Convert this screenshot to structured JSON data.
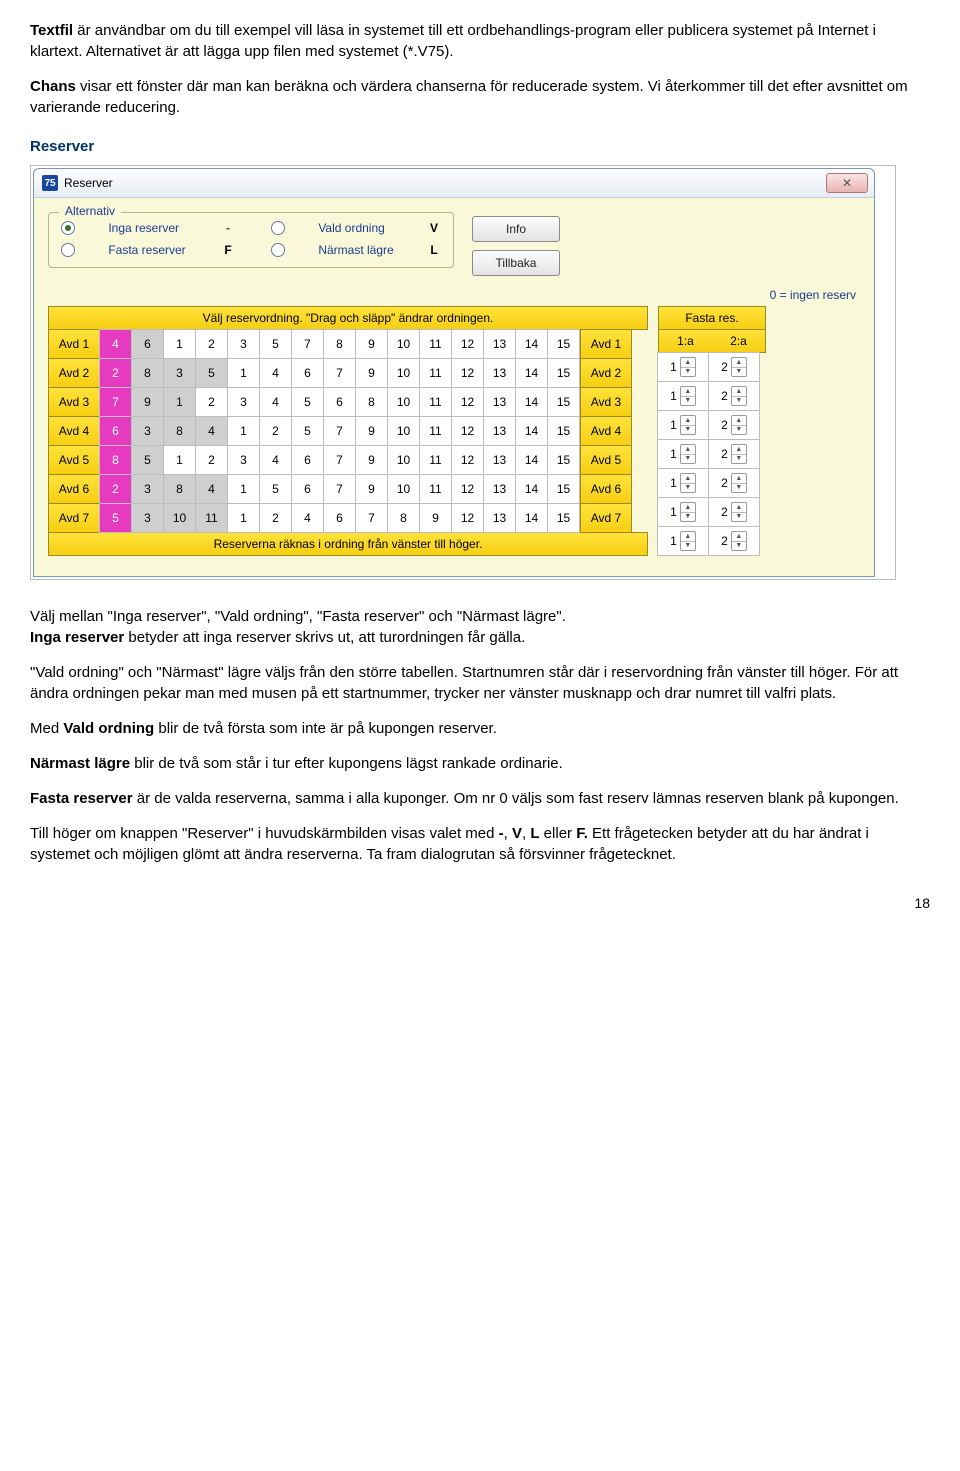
{
  "intro": {
    "textfil_label": "Textfil",
    "p1_rest": " är användbar om du till exempel vill läsa in systemet till ett ordbehandlings-program eller publicera systemet på Internet i klartext. Alternativet är att lägga upp filen med systemet (*.V75).",
    "chans_label": "Chans",
    "p2_rest": " visar ett fönster där man kan beräkna och värdera chanserna för reducerade system. Vi återkommer till det efter avsnittet om varierande reducering."
  },
  "section_heading": "Reserver",
  "dialog": {
    "title": "Reserver",
    "app_icon_text": "75",
    "close_glyph": "✕",
    "group_legend": "Alternativ",
    "radios": {
      "r1": "Inga reserver",
      "k1": "-",
      "r2": "Vald ordning",
      "k2": "V",
      "r3": "Fasta reserver",
      "k3": "F",
      "r4": "Närmast lägre",
      "k4": "L"
    },
    "buttons": {
      "info": "Info",
      "back": "Tillbaka"
    },
    "note_zero": "0 = ingen reserv",
    "main_header": "Välj reservordning. \"Drag och släpp\" ändrar ordningen.",
    "fasta_header": "Fasta res.",
    "fasta_sub1": "1:a",
    "fasta_sub2": "2:a",
    "footer_bar": "Reserverna räknas i ordning från vänster till höger.",
    "avd": [
      "Avd 1",
      "Avd 2",
      "Avd 3",
      "Avd 4",
      "Avd 5",
      "Avd 6",
      "Avd 7"
    ],
    "rows": [
      {
        "cells": [
          {
            "n": "4",
            "c": "mag"
          },
          {
            "n": "6",
            "c": "gray"
          },
          {
            "n": "1"
          },
          {
            "n": "2"
          },
          {
            "n": "3"
          },
          {
            "n": "5"
          },
          {
            "n": "7"
          },
          {
            "n": "8"
          },
          {
            "n": "9"
          },
          {
            "n": "10"
          },
          {
            "n": "11"
          },
          {
            "n": "12"
          },
          {
            "n": "13"
          },
          {
            "n": "14"
          },
          {
            "n": "15"
          }
        ]
      },
      {
        "cells": [
          {
            "n": "2",
            "c": "mag"
          },
          {
            "n": "8",
            "c": "gray"
          },
          {
            "n": "3",
            "c": "gray"
          },
          {
            "n": "5",
            "c": "gray"
          },
          {
            "n": "1"
          },
          {
            "n": "4"
          },
          {
            "n": "6"
          },
          {
            "n": "7"
          },
          {
            "n": "9"
          },
          {
            "n": "10"
          },
          {
            "n": "11"
          },
          {
            "n": "12"
          },
          {
            "n": "13"
          },
          {
            "n": "14"
          },
          {
            "n": "15"
          }
        ]
      },
      {
        "cells": [
          {
            "n": "7",
            "c": "mag"
          },
          {
            "n": "9",
            "c": "gray"
          },
          {
            "n": "1",
            "c": "gray"
          },
          {
            "n": "2"
          },
          {
            "n": "3"
          },
          {
            "n": "4"
          },
          {
            "n": "5"
          },
          {
            "n": "6"
          },
          {
            "n": "8"
          },
          {
            "n": "10"
          },
          {
            "n": "11"
          },
          {
            "n": "12"
          },
          {
            "n": "13"
          },
          {
            "n": "14"
          },
          {
            "n": "15"
          }
        ]
      },
      {
        "cells": [
          {
            "n": "6",
            "c": "mag"
          },
          {
            "n": "3",
            "c": "gray"
          },
          {
            "n": "8",
            "c": "gray"
          },
          {
            "n": "4",
            "c": "gray"
          },
          {
            "n": "1"
          },
          {
            "n": "2"
          },
          {
            "n": "5"
          },
          {
            "n": "7"
          },
          {
            "n": "9"
          },
          {
            "n": "10"
          },
          {
            "n": "11"
          },
          {
            "n": "12"
          },
          {
            "n": "13"
          },
          {
            "n": "14"
          },
          {
            "n": "15"
          }
        ]
      },
      {
        "cells": [
          {
            "n": "8",
            "c": "mag"
          },
          {
            "n": "5",
            "c": "gray"
          },
          {
            "n": "1"
          },
          {
            "n": "2"
          },
          {
            "n": "3"
          },
          {
            "n": "4"
          },
          {
            "n": "6"
          },
          {
            "n": "7"
          },
          {
            "n": "9"
          },
          {
            "n": "10"
          },
          {
            "n": "11"
          },
          {
            "n": "12"
          },
          {
            "n": "13"
          },
          {
            "n": "14"
          },
          {
            "n": "15"
          }
        ]
      },
      {
        "cells": [
          {
            "n": "2",
            "c": "mag"
          },
          {
            "n": "3",
            "c": "gray"
          },
          {
            "n": "8",
            "c": "gray"
          },
          {
            "n": "4",
            "c": "gray"
          },
          {
            "n": "1"
          },
          {
            "n": "5"
          },
          {
            "n": "6"
          },
          {
            "n": "7"
          },
          {
            "n": "9"
          },
          {
            "n": "10"
          },
          {
            "n": "11"
          },
          {
            "n": "12"
          },
          {
            "n": "13"
          },
          {
            "n": "14"
          },
          {
            "n": "15"
          }
        ]
      },
      {
        "cells": [
          {
            "n": "5",
            "c": "mag"
          },
          {
            "n": "3",
            "c": "gray"
          },
          {
            "n": "10",
            "c": "gray"
          },
          {
            "n": "11",
            "c": "gray"
          },
          {
            "n": "1"
          },
          {
            "n": "2"
          },
          {
            "n": "4"
          },
          {
            "n": "6"
          },
          {
            "n": "7"
          },
          {
            "n": "8"
          },
          {
            "n": "9"
          },
          {
            "n": "12"
          },
          {
            "n": "13"
          },
          {
            "n": "14"
          },
          {
            "n": "15"
          }
        ]
      }
    ],
    "fasta_rows": [
      {
        "a": "1",
        "b": "2"
      },
      {
        "a": "1",
        "b": "2"
      },
      {
        "a": "1",
        "b": "2"
      },
      {
        "a": "1",
        "b": "2"
      },
      {
        "a": "1",
        "b": "2"
      },
      {
        "a": "1",
        "b": "2"
      },
      {
        "a": "1",
        "b": "2"
      }
    ]
  },
  "body_text": {
    "p1a": "Välj mellan \"Inga reserver\", \"Vald ordning\", \"Fasta reserver\" och \"Närmast lägre\".",
    "p1b_bold": "Inga reserver",
    "p1b_rest": " betyder att inga reserver skrivs ut, att turordningen får gälla.",
    "p2": "\"Vald ordning\" och \"Närmast\" lägre väljs från den större tabellen. Startnumren står där i reservordning från vänster till höger. För att ändra ordningen pekar man med musen på ett startnummer, trycker ner vänster musknapp och drar numret till valfri plats.",
    "p3a": "Med ",
    "p3b_bold": "Vald ordning",
    "p3c": " blir de två första som inte är på kupongen reserver.",
    "p4_bold": "Närmast lägre",
    "p4_rest": " blir de två som står i tur efter kupongens lägst rankade ordinarie.",
    "p5_bold": "Fasta reserver",
    "p5_rest": " är de valda reserverna, samma i alla kuponger. Om nr 0 väljs som fast reserv lämnas reserven blank på kupongen.",
    "p6a": "Till höger om knappen \"Reserver\" i huvudskärmbilden visas valet med ",
    "p6b_bold": "-",
    "p6c": ", ",
    "p6d_bold": "V",
    "p6e": ", ",
    "p6f_bold": "L",
    "p6g": " eller ",
    "p6h_bold": "F.",
    "p6i": " Ett frågetecken betyder att du har ändrat i systemet och möjligen glömt att ändra reserverna. Ta fram dialogrutan så försvinner frågetecknet."
  },
  "page_number": "18"
}
